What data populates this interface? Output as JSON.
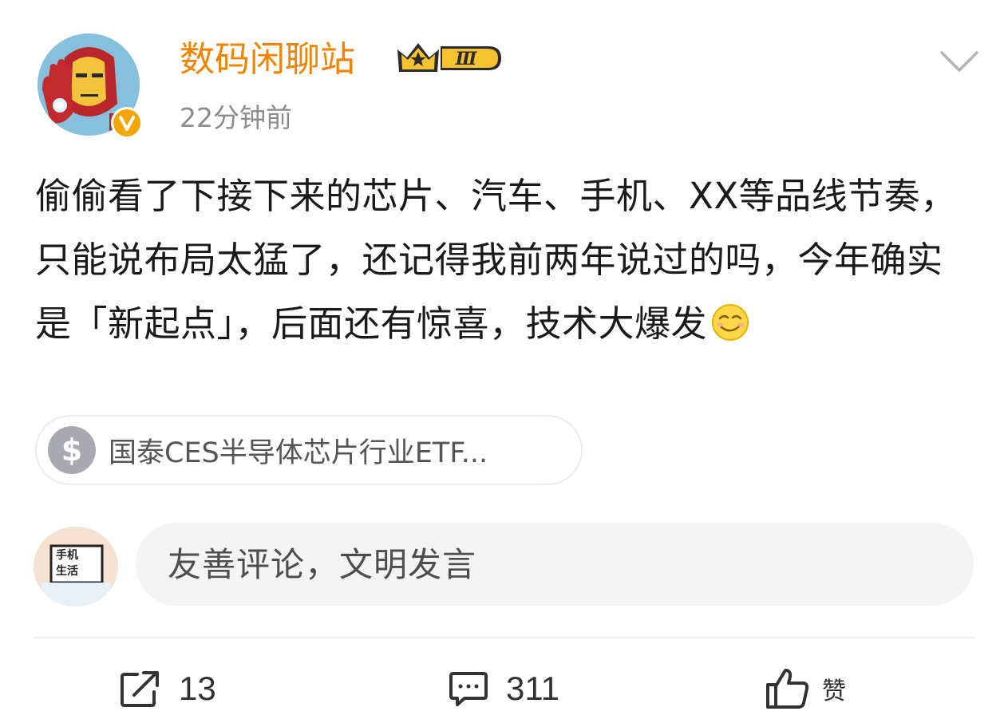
{
  "author": {
    "name": "数码闲聊站",
    "vip_level": "Ⅲ",
    "verified": true,
    "time": "22分钟前"
  },
  "post": {
    "text": "偷偷看了下接下来的芯片、汽车、手机、XX等品线节奏，只能说布局太猛了，还记得我前两年说过的吗，今年确实是「新起点」，后面还有惊喜，技术大爆发",
    "emoji": "smirk-face"
  },
  "fund_chip": {
    "icon": "dollar-icon",
    "name": "国泰CES半导体芯片行业ETF..."
  },
  "comment_box": {
    "placeholder": "友善评论，文明发言",
    "avatar_text": [
      "手机",
      "生活"
    ]
  },
  "actions": {
    "repost_count": "13",
    "comment_count": "311",
    "like_label": "赞"
  },
  "colors": {
    "username": "#f08300",
    "timestamp": "#8c8c8c",
    "verified_badge": "#f5a400",
    "chip_icon_bg": "#a9aab1",
    "input_bg": "#f4f4f4"
  }
}
